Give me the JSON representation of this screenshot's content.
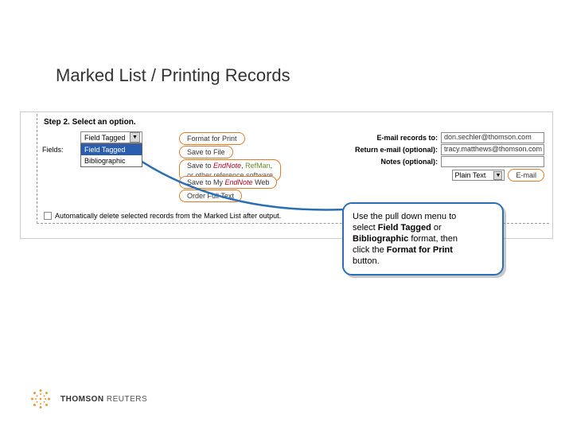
{
  "title": "Marked List / Printing Records",
  "step_header": "Step 2. Select an option.",
  "format_label": "Fields:",
  "format_selected": "Field Tagged",
  "format_options": [
    "Field Tagged",
    "Bibliographic"
  ],
  "buttons": {
    "print": "Format for Print",
    "save_file": "Save to File",
    "save_ref_a": "Save to ",
    "save_ref_endnote": "EndNote",
    "save_ref_refman": "RefMan",
    "save_ref_other": "or other reference software",
    "save_my": "Save to My ",
    "save_my_brand": "EndNote",
    "save_my_web": "Web",
    "order": "Order Full Text",
    "email_btn": "E-mail"
  },
  "email": {
    "to_label": "E-mail records to:",
    "to_value": "don.sechler@thomson.com",
    "return_label": "Return e-mail (optional):",
    "return_value": "tracy.matthews@thomson.com",
    "notes_label": "Notes (optional):",
    "notes_value": "",
    "format_value": "Plain Text"
  },
  "auto_delete": "Automatically delete selected records from the Marked List after output.",
  "callout": {
    "l1": "Use the pull down menu to",
    "l2a": "select ",
    "l2b": "Field Tagged",
    "l2c": " or",
    "l3a": "Bibliographic",
    "l3b": " format, then",
    "l4a": "click the ",
    "l4b": "Format for Print",
    "l5": "button."
  },
  "brand": {
    "a": "THOMSON",
    "b": " REUTERS"
  }
}
